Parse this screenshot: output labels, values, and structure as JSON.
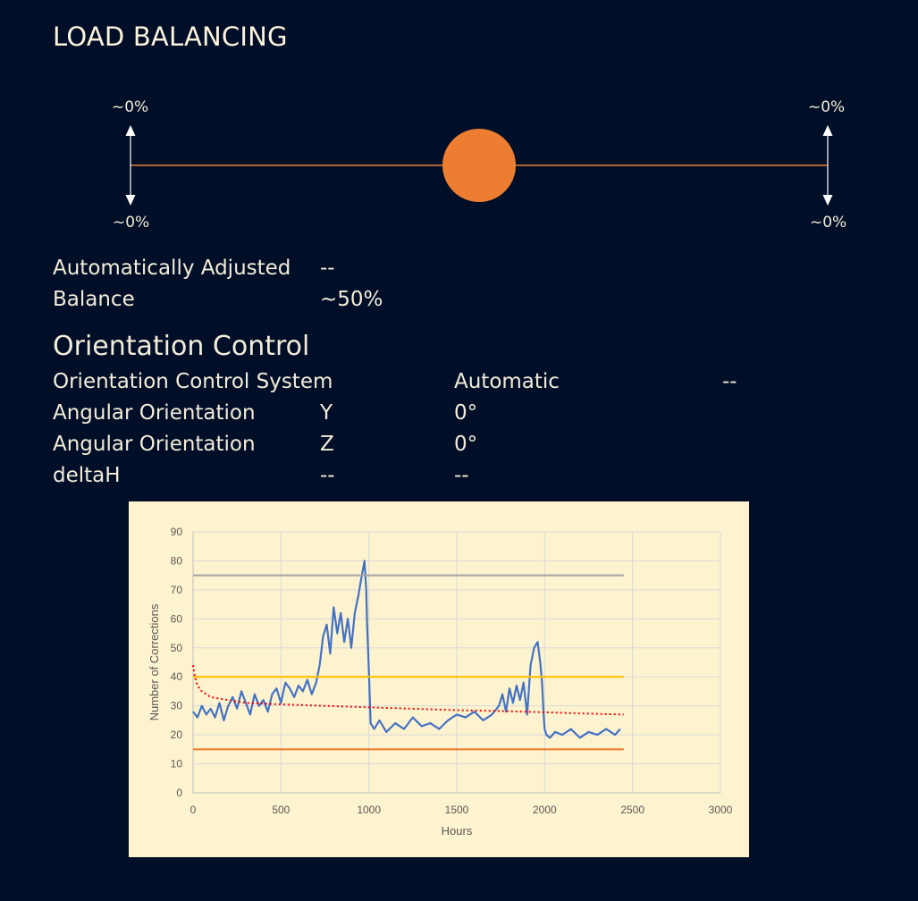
{
  "header": {
    "title": "LOAD BALANCING"
  },
  "balance_indicator": {
    "top_left": "~0%",
    "top_right": "~0%",
    "bottom_left": "~0%",
    "bottom_right": "~0%",
    "position_fraction": 0.5,
    "knob_color": "#ed7d31",
    "line_color": "#ed7d31"
  },
  "load_info": [
    {
      "label": "Automatically Adjusted",
      "value": "--"
    },
    {
      "label": "Balance",
      "value": "~50%"
    }
  ],
  "orientation": {
    "title": "Orientation Control",
    "system": {
      "label": "Orientation Control System",
      "mode": "Automatic",
      "status": "--"
    },
    "rows": [
      {
        "label": "Angular Orientation",
        "axis": "Y",
        "value": "0°"
      },
      {
        "label": "Angular Orientation",
        "axis": "Z",
        "value": "0°"
      },
      {
        "label": "deltaH",
        "axis": "--",
        "value": "--"
      }
    ]
  },
  "chart_data": {
    "type": "line",
    "xlabel": "Hours",
    "ylabel": "Number of Corrections",
    "xlim": [
      0,
      3000
    ],
    "ylim": [
      0,
      90
    ],
    "xticks": [
      0,
      500,
      1000,
      1500,
      2000,
      2500,
      3000
    ],
    "yticks": [
      0,
      10,
      20,
      30,
      40,
      50,
      60,
      70,
      80,
      90
    ],
    "grid": true,
    "background": "#fdf3cf",
    "series": [
      {
        "style": "line",
        "color": "#4472c4",
        "x": [
          0,
          25,
          50,
          75,
          100,
          125,
          150,
          175,
          200,
          225,
          250,
          275,
          300,
          325,
          350,
          375,
          400,
          425,
          450,
          475,
          500,
          525,
          550,
          575,
          600,
          625,
          650,
          675,
          700,
          720,
          740,
          760,
          780,
          800,
          820,
          840,
          860,
          880,
          900,
          920,
          940,
          960,
          975,
          985,
          990,
          1000,
          1010,
          1030,
          1060,
          1100,
          1150,
          1200,
          1250,
          1300,
          1350,
          1400,
          1450,
          1500,
          1550,
          1600,
          1650,
          1700,
          1740,
          1760,
          1780,
          1800,
          1820,
          1840,
          1860,
          1880,
          1900,
          1920,
          1940,
          1960,
          1975,
          1985,
          1995,
          2000,
          2010,
          2030,
          2060,
          2100,
          2150,
          2200,
          2250,
          2300,
          2350,
          2400,
          2430
        ],
        "y": [
          28,
          26,
          30,
          27,
          29,
          26,
          31,
          25,
          30,
          33,
          29,
          35,
          31,
          27,
          34,
          30,
          32,
          28,
          34,
          36,
          31,
          38,
          36,
          33,
          37,
          35,
          39,
          34,
          38,
          44,
          54,
          58,
          48,
          64,
          55,
          62,
          52,
          60,
          50,
          62,
          68,
          75,
          80,
          70,
          58,
          42,
          24,
          22,
          25,
          21,
          24,
          22,
          26,
          23,
          24,
          22,
          25,
          27,
          26,
          28,
          25,
          27,
          30,
          34,
          28,
          36,
          31,
          37,
          32,
          38,
          27,
          44,
          50,
          52,
          45,
          38,
          26,
          22,
          20,
          19,
          21,
          20,
          22,
          19,
          21,
          20,
          22,
          20,
          22
        ]
      },
      {
        "style": "line",
        "color": "#a5a5a5",
        "x": [
          0,
          2450
        ],
        "y": [
          75,
          75
        ]
      },
      {
        "style": "line",
        "color": "#ffc000",
        "x": [
          0,
          2450
        ],
        "y": [
          40,
          40
        ]
      },
      {
        "style": "line",
        "color": "#ed7d31",
        "x": [
          0,
          2450
        ],
        "y": [
          15,
          15
        ]
      },
      {
        "style": "dotted",
        "color": "#ff0000",
        "x": [
          0,
          10,
          25,
          50,
          100,
          200,
          300,
          500,
          750,
          1000,
          1250,
          1500,
          1750,
          2000,
          2250,
          2450
        ],
        "y": [
          44,
          40,
          37,
          35,
          33,
          32,
          31,
          30.5,
          30,
          29.5,
          29,
          28.5,
          28.2,
          27.8,
          27.3,
          27
        ]
      }
    ]
  }
}
